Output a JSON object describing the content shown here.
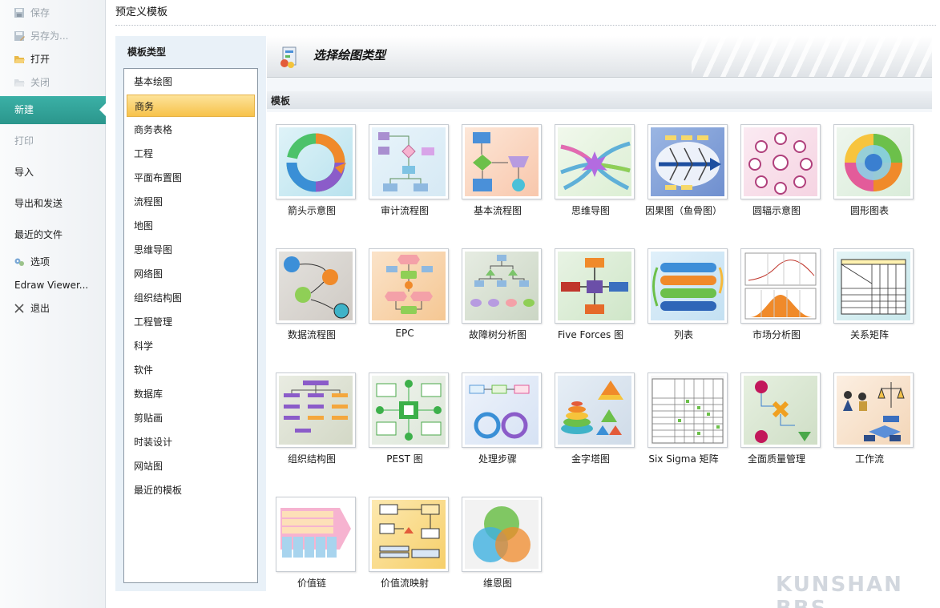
{
  "nav": {
    "items": [
      {
        "label": "保存",
        "icon": "save-icon",
        "disabled": true
      },
      {
        "label": "另存为...",
        "icon": "save-as-icon",
        "disabled": true
      },
      {
        "label": "打开",
        "icon": "open-folder-icon",
        "disabled": false
      },
      {
        "label": "关闭",
        "icon": "close-folder-icon",
        "disabled": true
      },
      {
        "label": "新建",
        "active": true
      },
      {
        "label": "打印",
        "disabled": true
      },
      {
        "label": "导入"
      },
      {
        "label": "导出和发送"
      },
      {
        "label": "最近的文件"
      },
      {
        "label": "选项",
        "icon": "options-icon"
      },
      {
        "label": "Edraw Viewer..."
      },
      {
        "label": "退出",
        "icon": "exit-icon"
      }
    ]
  },
  "header": {
    "title": "预定义模板"
  },
  "type_panel": {
    "title": "模板类型",
    "items": [
      "基本绘图",
      "商务",
      "商务表格",
      "工程",
      "平面布置图",
      "流程图",
      "地图",
      "思维导图",
      "网络图",
      "组织结构图",
      "工程管理",
      "科学",
      "软件",
      "数据库",
      "剪贴画",
      "时装设计",
      "网站图",
      "最近的模板"
    ],
    "selected_index": 1
  },
  "banner": {
    "title": "选择绘图类型"
  },
  "templates": {
    "section_title": "模板",
    "items": [
      {
        "label": "箭头示意图",
        "icon": "arrow-cycle-thumb"
      },
      {
        "label": "审计流程图",
        "icon": "audit-flow-thumb"
      },
      {
        "label": "基本流程图",
        "icon": "basic-flow-thumb"
      },
      {
        "label": "思维导图",
        "icon": "mind-map-thumb"
      },
      {
        "label": "因果图（鱼骨图）",
        "icon": "fishbone-thumb"
      },
      {
        "label": "圆辐示意图",
        "icon": "radial-thumb"
      },
      {
        "label": "圆形图表",
        "icon": "circle-chart-thumb"
      },
      {
        "label": "数据流程图",
        "icon": "data-flow-thumb"
      },
      {
        "label": "EPC",
        "icon": "epc-thumb"
      },
      {
        "label": "故障树分析图",
        "icon": "fault-tree-thumb"
      },
      {
        "label": "Five Forces 图",
        "icon": "five-forces-thumb"
      },
      {
        "label": "列表",
        "icon": "list-thumb"
      },
      {
        "label": "市场分析图",
        "icon": "market-analysis-thumb"
      },
      {
        "label": "关系矩阵",
        "icon": "relation-matrix-thumb"
      },
      {
        "label": "组织结构图",
        "icon": "org-chart-thumb"
      },
      {
        "label": "PEST 图",
        "icon": "pest-thumb"
      },
      {
        "label": "处理步骤",
        "icon": "process-steps-thumb"
      },
      {
        "label": "金字塔图",
        "icon": "pyramid-thumb"
      },
      {
        "label": "Six Sigma 矩阵",
        "icon": "six-sigma-thumb"
      },
      {
        "label": "全面质量管理",
        "icon": "tqm-thumb"
      },
      {
        "label": "工作流",
        "icon": "workflow-thumb"
      },
      {
        "label": "价值链",
        "icon": "value-chain-thumb"
      },
      {
        "label": "价值流映射",
        "icon": "value-stream-thumb"
      },
      {
        "label": "维恩图",
        "icon": "venn-thumb"
      }
    ]
  },
  "watermark": "KUNSHAN BBS"
}
